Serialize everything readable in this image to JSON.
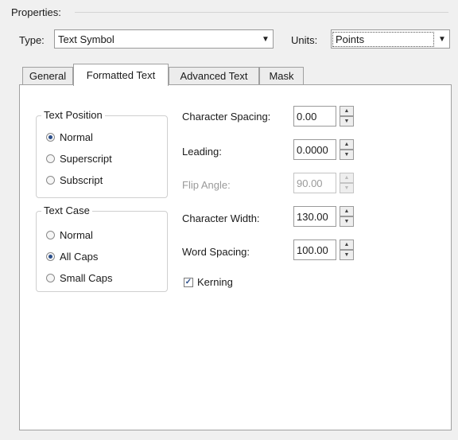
{
  "properties": {
    "title": "Properties:"
  },
  "type_field": {
    "label": "Type:",
    "value": "Text Symbol"
  },
  "units_field": {
    "label": "Units:",
    "value": "Points"
  },
  "tabs": [
    {
      "label": "General"
    },
    {
      "label": "Formatted Text"
    },
    {
      "label": "Advanced Text"
    },
    {
      "label": "Mask"
    }
  ],
  "text_position": {
    "legend": "Text Position",
    "options": [
      "Normal",
      "Superscript",
      "Subscript"
    ],
    "selected": "Normal"
  },
  "text_case": {
    "legend": "Text Case",
    "options": [
      "Normal",
      "All Caps",
      "Small Caps"
    ],
    "selected": "All Caps"
  },
  "fields": {
    "character_spacing": {
      "label": "Character Spacing:",
      "value": "0.00"
    },
    "leading": {
      "label": "Leading:",
      "value": "0.0000"
    },
    "flip_angle": {
      "label": "Flip Angle:",
      "value": "90.00"
    },
    "character_width": {
      "label": "Character Width:",
      "value": "130.00"
    },
    "word_spacing": {
      "label": "Word Spacing:",
      "value": "100.00"
    }
  },
  "kerning": {
    "label": "Kerning",
    "checked": true
  },
  "icons": {
    "dropdown": "chevron-down-icon",
    "spin_up": "arrow-up-icon",
    "spin_down": "arrow-down-icon",
    "check": "checkmark-icon"
  }
}
